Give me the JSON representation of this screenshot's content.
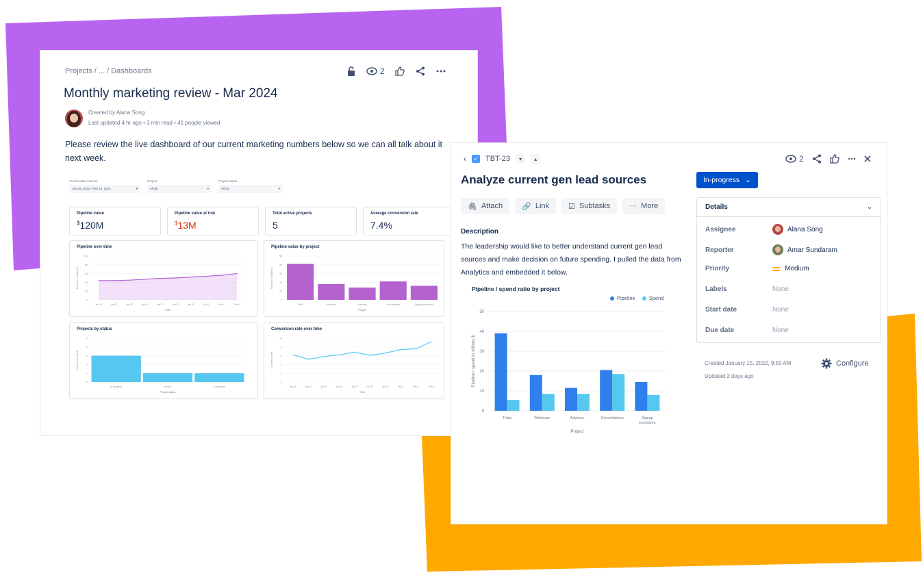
{
  "colors": {
    "purple": "#B864F0",
    "orange": "#FFA800",
    "blue": "#0052CC",
    "pipeline": "#2F80ED",
    "spend": "#56C8F0",
    "chart_purple": "#B462D0"
  },
  "dashboard": {
    "breadcrumb": "Projects  /  ...  /  Dashboards",
    "watchers": "2",
    "title": "Monthly marketing review - Mar 2024",
    "created_by": "Created by Alana Song",
    "updated": "Last updated 4 hr ago  •  3 min read  •  41 people viewed",
    "intro": "Please review the live dashboard of our current marketing numbers below so we can all talk about it next week.",
    "filters": [
      {
        "label": "Current date interval",
        "value": "Jan 16, 2023 - Feb 16, 2023"
      },
      {
        "label": "Project",
        "value": "All (5)"
      },
      {
        "label": "Project status",
        "value": "All (3)"
      }
    ],
    "kpis": [
      {
        "label": "Pipeline value",
        "sup": "$",
        "value": "120M"
      },
      {
        "label": "Pipeline value at risk",
        "sup": "$",
        "value": "13M"
      },
      {
        "label": "Total active projects",
        "sup": "",
        "value": "5"
      },
      {
        "label": "Average conversion rate",
        "sup": "",
        "value": "7.4%"
      }
    ],
    "charts": {
      "pipeline_time": {
        "title": "Pipeline over time",
        "ylabel": "Pipeline in millions $",
        "xlabel": "Time",
        "x": [
          "Jan 16",
          "Jan 21",
          "Jan 23",
          "Jan 25",
          "Jan 27",
          "Jan 29",
          "Jan 31",
          "Feb 2",
          "Feb 4",
          "Feb 6"
        ],
        "y": [
          44,
          44,
          45,
          47,
          49,
          50,
          52,
          54,
          56,
          60
        ],
        "ticks": [
          "100",
          "80",
          "60",
          "40",
          "20",
          "0"
        ]
      },
      "pipeline_project": {
        "title": "Pipeline value by project",
        "ylabel": "Pipeline in millions $",
        "xlabel": "Project",
        "categories": [
          "Trials",
          "Webinars",
          "Advisory",
          "Consultations",
          "Signup incentives"
        ],
        "values": [
          41,
          18,
          14,
          21,
          16
        ],
        "ticks": [
          "50",
          "40",
          "30",
          "20",
          "10",
          "0"
        ]
      },
      "projects_status": {
        "title": "Projects by status",
        "ylabel": "Number of projects",
        "xlabel": "Project status",
        "categories": [
          "In progress",
          "At risk",
          "Completed"
        ],
        "values": [
          3,
          1,
          1
        ],
        "ticks": [
          "5",
          "4",
          "3",
          "2",
          "1",
          "0"
        ]
      },
      "conversion": {
        "title": "Conversion rate over time",
        "ylabel": "Conversion rate",
        "xlabel": "Time",
        "x": [
          "Jan 16",
          "Jan 21",
          "Jan 23",
          "Jan 25",
          "Jan 27",
          "Jan 29",
          "Jan 31",
          "Feb 2",
          "Feb 4",
          "Feb 6"
        ],
        "y": [
          6.2,
          5.2,
          5.8,
          6.2,
          6.8,
          6.1,
          6.6,
          7.4,
          7.6,
          9.2
        ],
        "ticks": [
          "10",
          "8",
          "6",
          "4",
          "2",
          "0"
        ]
      }
    }
  },
  "issue": {
    "key": "TBT-23",
    "watchers": "2",
    "title": "Analyze current gen lead sources",
    "actions": {
      "attach": "Attach",
      "link": "Link",
      "subtasks": "Subtasks",
      "more": "More"
    },
    "description_heading": "Description",
    "description": "The leadership would like to better understand current gen lead sources and make decision on future spending. I pulled the data from Analytics and embedded it below.",
    "status": "In-progress",
    "details": {
      "heading": "Details",
      "rows": [
        {
          "label": "Assignee",
          "value": "Alana Song"
        },
        {
          "label": "Reporter",
          "value": "Amar Sundaram"
        },
        {
          "label": "Priority",
          "value": "Medium"
        },
        {
          "label": "Labels",
          "value": "None"
        },
        {
          "label": "Start date",
          "value": "None"
        },
        {
          "label": "Due date",
          "value": "None"
        }
      ]
    },
    "created": "Created January 15, 2022, 9:50 AM",
    "updated": "Updated 2 days ago",
    "configure": "Configure"
  },
  "chart_data": {
    "type": "bar",
    "title": "Pipeline / spend ratio by project",
    "xlabel": "Project",
    "ylabel": "Pipeline / spend in millions $",
    "categories": [
      "Trials",
      "Webinars",
      "Advisory",
      "Consultations",
      "Signup incentives"
    ],
    "ylim": [
      0,
      50
    ],
    "yticks": [
      "50",
      "40",
      "30",
      "20",
      "10",
      "0"
    ],
    "legend": "top-right",
    "series": [
      {
        "name": "Pipeline",
        "values": [
          39,
          18,
          11.5,
          20.5,
          14.5
        ]
      },
      {
        "name": "Spend",
        "values": [
          5.5,
          8.5,
          8.5,
          18.5,
          8
        ]
      }
    ]
  }
}
